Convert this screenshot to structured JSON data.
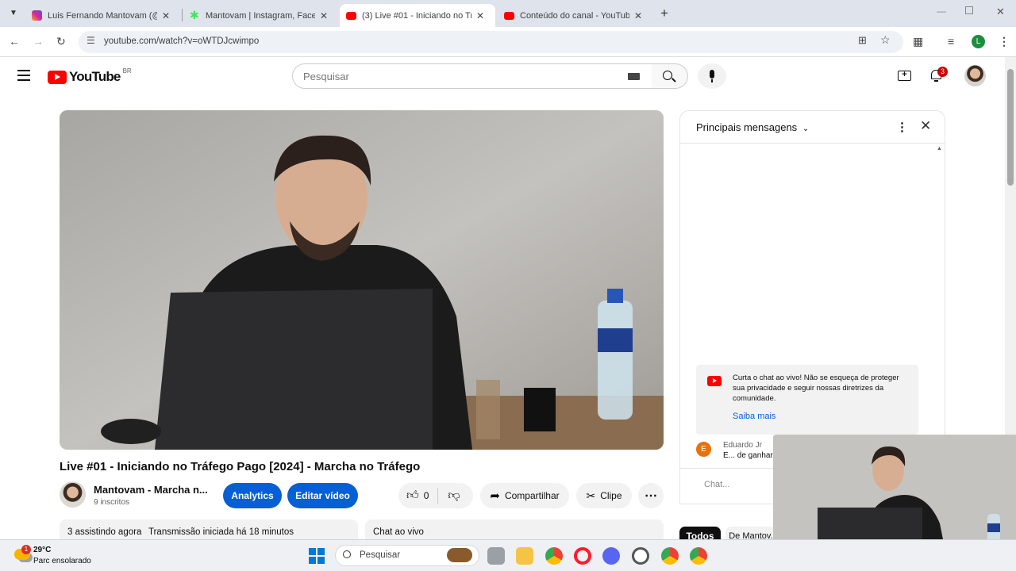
{
  "browser": {
    "tabs": [
      {
        "title": "Luis Fernando Mantovam (@m...",
        "favicon": "instagram-icon",
        "color": "#d6249f"
      },
      {
        "title": "Mantovam | Instagram, Faceboo...",
        "favicon": "linktree-icon",
        "color": "#43e55e"
      },
      {
        "title": "(3) Live #01 - Iniciando no Tráfe...",
        "favicon": "youtube-icon",
        "color": "#ff0000"
      },
      {
        "title": "Conteúdo do canal - YouTube S...",
        "favicon": "youtube-icon",
        "color": "#ff0000"
      }
    ],
    "active_tab": 2,
    "url": "youtube.com/watch?v=oWTDJcwimpo",
    "profile_letter": "L"
  },
  "youtube": {
    "logo_text": "YouTube",
    "region": "BR",
    "search_placeholder": "Pesquisar",
    "notification_count": "3",
    "video": {
      "title": "Live #01 - Iniciando no Tráfego Pago [2024] - Marcha no Tráfego",
      "channel_name": "Mantovam - Marcha n...",
      "subscribers": "9 inscritos",
      "analytics_label": "Analytics",
      "edit_label": "Editar vídeo",
      "likes": "0",
      "share_label": "Compartilhar",
      "clip_label": "Clipe",
      "watching_now": "3 assistindo agora",
      "stream_started": "Transmissão iniciada há 18 minutos",
      "live_chat_label": "Chat ao vivo"
    },
    "chat": {
      "mode_label": "Principais mensagens",
      "welcome_text": "Curta o chat ao vivo! Não se esqueça de proteger sua privacidade e seguir nossas diretrizes da comunidade.",
      "learn_more": "Saiba mais",
      "message_author": "Eduardo Jr",
      "message_text": "E... de ganhar 7k",
      "message_initial": "E",
      "input_placeholder": "Chat...",
      "filter_all": "Todos",
      "filter_mantovam": "De Mantov..."
    }
  },
  "taskbar": {
    "weather_temp": "29°C",
    "weather_desc": "Parc ensolarado",
    "weather_badge": "1",
    "search_placeholder": "Pesquisar"
  }
}
